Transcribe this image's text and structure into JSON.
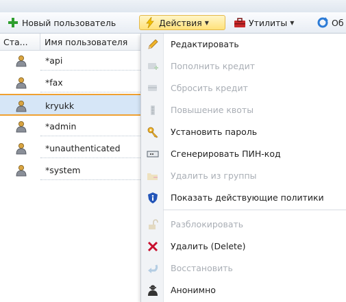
{
  "toolbar": {
    "new_user": "Новый пользователь",
    "actions": "Действия",
    "utilities": "Утилиты",
    "overflow": "Об"
  },
  "grid": {
    "col_status": "Ста...",
    "col_username": "Имя пользователя"
  },
  "users": [
    {
      "name": "*api",
      "selected": false
    },
    {
      "name": "*fax",
      "selected": false
    },
    {
      "name": "kryukk",
      "selected": true
    },
    {
      "name": "*admin",
      "selected": false
    },
    {
      "name": "*unauthenticated",
      "selected": false
    },
    {
      "name": "*system",
      "selected": false
    }
  ],
  "menu": {
    "items": [
      {
        "label": "Редактировать",
        "enabled": true,
        "icon": "pencil-icon"
      },
      {
        "label": "Пополнить кредит",
        "enabled": false,
        "icon": "add-credit-icon"
      },
      {
        "label": "Сбросить кредит",
        "enabled": false,
        "icon": "reset-credit-icon"
      },
      {
        "label": "Повышение квоты",
        "enabled": false,
        "icon": "quota-icon"
      },
      {
        "label": "Установить пароль",
        "enabled": true,
        "icon": "key-icon"
      },
      {
        "label": "Сгенерировать ПИН-код",
        "enabled": true,
        "icon": "pin-code-icon"
      },
      {
        "label": "Удалить из группы",
        "enabled": false,
        "icon": "remove-from-group-icon"
      },
      {
        "label": "Показать действующие политики",
        "enabled": true,
        "icon": "shield-icon"
      },
      {
        "label": "Разблокировать",
        "enabled": false,
        "icon": "unlock-icon"
      },
      {
        "label": "Удалить (Delete)",
        "enabled": true,
        "icon": "delete-x-icon"
      },
      {
        "label": "Восстановить",
        "enabled": false,
        "icon": "restore-icon"
      },
      {
        "label": "Анонимно",
        "enabled": true,
        "icon": "anonymous-icon"
      }
    ]
  },
  "colors": {
    "selection_border": "#f0a030",
    "selection_fill": "#d6e6f7",
    "pressed_button": "#ffe27a",
    "disabled_text": "#a9aeb5"
  }
}
